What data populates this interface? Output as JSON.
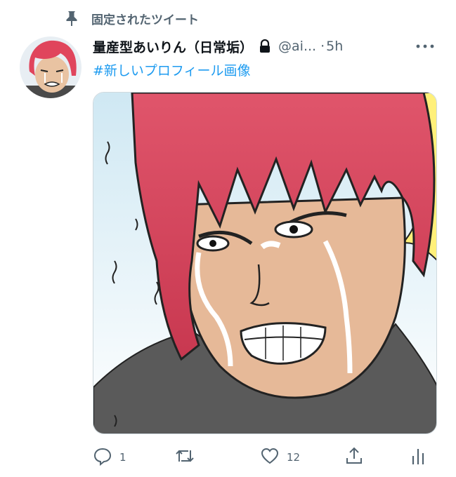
{
  "pinned": {
    "label": "固定されたツイート",
    "icon": "pin-icon"
  },
  "author": {
    "name": "量産型あいりん（日常垢）",
    "handle": "@ai...",
    "separator": "·",
    "time": "5h",
    "protected_icon": "lock-icon"
  },
  "tweet": {
    "text": "#新しいプロフィール画像"
  },
  "media": {
    "description_icon": "manga-illustration"
  },
  "actions": {
    "reply_count": "1",
    "retweet_count": "",
    "like_count": "12"
  },
  "colors": {
    "link": "#1d9bf0",
    "secondary": "#536471",
    "text": "#0f1419"
  }
}
